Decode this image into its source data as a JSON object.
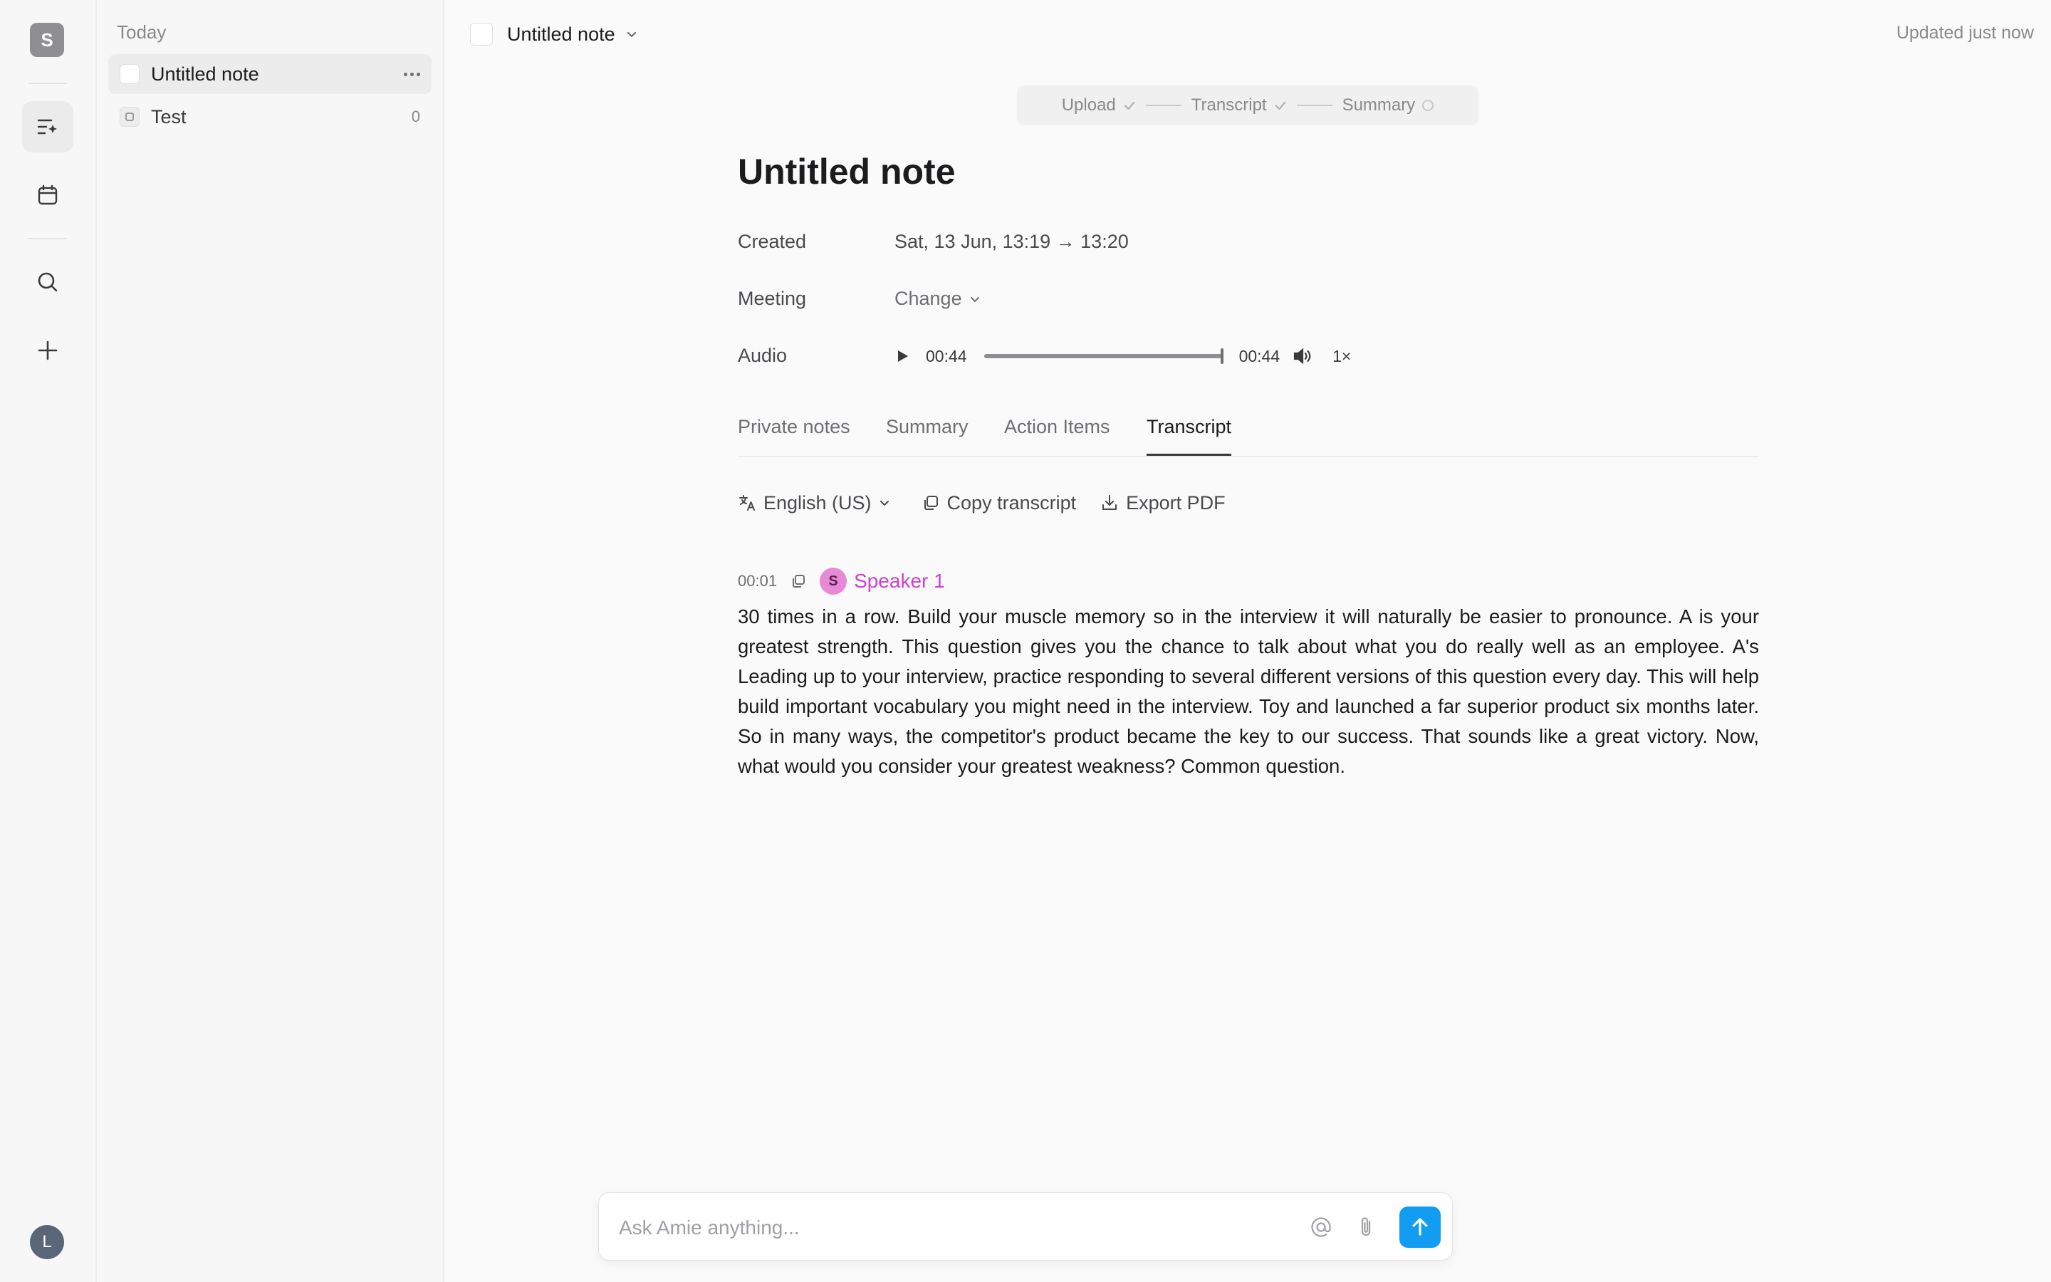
{
  "rail": {
    "workspace_initial": "S",
    "user_initial": "L",
    "icons": [
      "notes-icon",
      "calendar-icon",
      "search-icon",
      "plus-icon"
    ]
  },
  "sidebar": {
    "group_label": "Today",
    "items": [
      {
        "label": "Untitled note",
        "active": true
      },
      {
        "label": "Test",
        "count": "0"
      }
    ]
  },
  "header": {
    "title": "Untitled note",
    "updated": "Updated just now"
  },
  "stepper": {
    "steps": [
      {
        "label": "Upload",
        "state": "done"
      },
      {
        "label": "Transcript",
        "state": "done"
      },
      {
        "label": "Summary",
        "state": "pending"
      }
    ]
  },
  "note": {
    "title": "Untitled note",
    "created_label": "Created",
    "created_value": "Sat, 13 Jun, 13:19 → 13:20",
    "meeting_label": "Meeting",
    "meeting_value": "Change",
    "audio_label": "Audio",
    "audio": {
      "current": "00:44",
      "duration": "00:44",
      "progress": 1.0,
      "speed": "1×"
    }
  },
  "tabs": [
    {
      "label": "Private notes"
    },
    {
      "label": "Summary"
    },
    {
      "label": "Action Items"
    },
    {
      "label": "Transcript",
      "active": true
    }
  ],
  "toolbar": {
    "language": "English (US)",
    "copy_label": "Copy transcript",
    "export_label": "Export PDF"
  },
  "transcript": {
    "segments": [
      {
        "time": "00:01",
        "speaker_initial": "S",
        "speaker": "Speaker 1",
        "text": "30 times in a row. Build your muscle memory so in the interview it will naturally be easier to pronounce. A is your greatest strength. This question gives you the chance to talk about what you do really well as an employee. A's Leading up to your interview, practice responding to several different versions of this question every day. This will help build important vocabulary you might need in the interview. Toy and launched a far superior product six months later. So in many ways, the competitor's product became the key to our success. That sounds like a great victory. Now, what would you consider your greatest weakness? Common question."
      }
    ]
  },
  "ask": {
    "placeholder": "Ask Amie anything...",
    "send_color": "#129cf2"
  },
  "colors": {
    "accent": "#129cf2",
    "speaker": "#cf3fd0",
    "speaker_avatar": "#e889d6"
  }
}
